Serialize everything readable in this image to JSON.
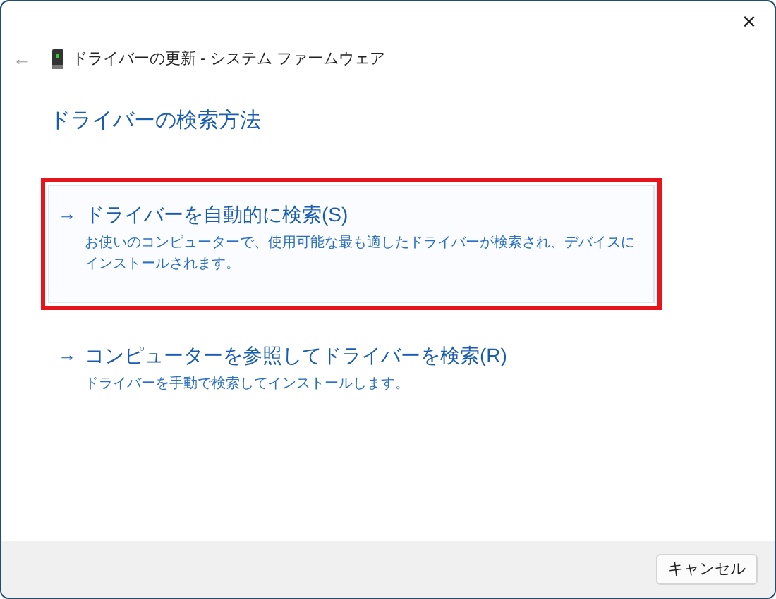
{
  "window": {
    "title": "ドライバーの更新 - システム ファームウェア",
    "close": "✕",
    "back": "←"
  },
  "heading": "ドライバーの検索方法",
  "options": [
    {
      "arrow": "→",
      "title": "ドライバーを自動的に検索(S)",
      "description": "お使いのコンピューターで、使用可能な最も適したドライバーが検索され、デバイスにインストールされます。",
      "selected": true,
      "highlighted": true
    },
    {
      "arrow": "→",
      "title": "コンピューターを参照してドライバーを検索(R)",
      "description": "ドライバーを手動で検索してインストールします。",
      "selected": false,
      "highlighted": false
    }
  ],
  "buttons": [
    "キャンセル"
  ]
}
